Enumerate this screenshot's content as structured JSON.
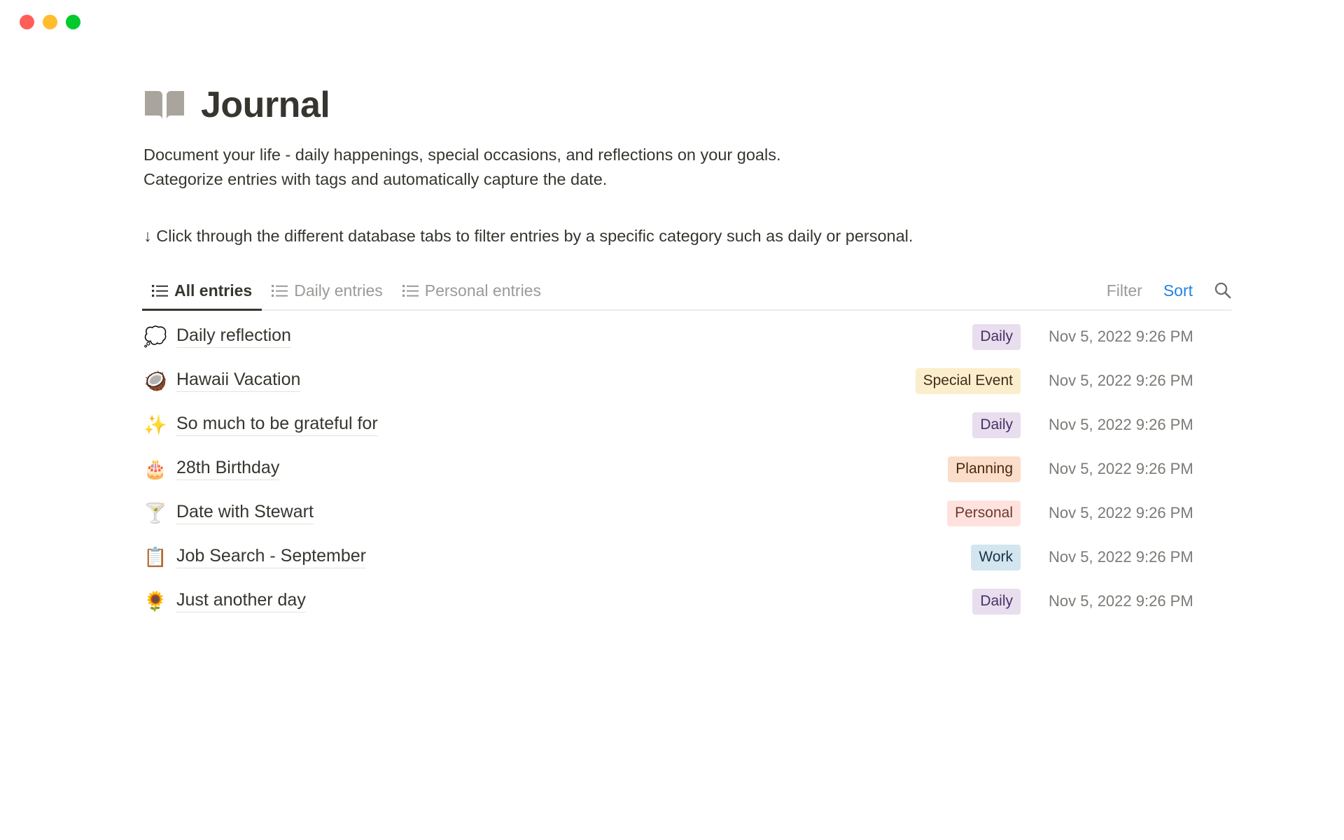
{
  "window": {
    "controls": [
      {
        "name": "close",
        "color": "#FF5F57"
      },
      {
        "name": "minimize",
        "color": "#FFBD2E"
      },
      {
        "name": "maximize",
        "color": "#00CA2C"
      }
    ]
  },
  "header": {
    "icon": "open-book-icon",
    "icon_color": "#A9A49C",
    "title": "Journal",
    "description_line1": "Document your life - daily happenings, special occasions, and reflections on your goals.",
    "description_line2": "Categorize entries with tags and automatically capture the date.",
    "hint": "↓ Click through the different database tabs to filter entries by a specific category such as daily or personal."
  },
  "toolbar": {
    "tabs": [
      {
        "label": "All entries",
        "icon": "list-icon",
        "active": true
      },
      {
        "label": "Daily entries",
        "icon": "list-icon",
        "active": false
      },
      {
        "label": "Personal entries",
        "icon": "list-icon",
        "active": false
      }
    ],
    "filter_label": "Filter",
    "sort_label": "Sort",
    "sort_color": "#2383E2",
    "search_icon": "search-icon"
  },
  "tag_styles": {
    "Daily": {
      "bg": "#E8DEEE",
      "fg": "#492F64"
    },
    "Special Event": {
      "bg": "#FBEECC",
      "fg": "#402C1B"
    },
    "Planning": {
      "bg": "#FADEC9",
      "fg": "#49290E"
    },
    "Personal": {
      "bg": "#FFE2DD",
      "fg": "#6E3630"
    },
    "Work": {
      "bg": "#D3E5EF",
      "fg": "#183347"
    }
  },
  "entries": [
    {
      "emoji": "💭",
      "emoji_name": "thought-balloon-icon",
      "title": "Daily reflection",
      "tag": "Daily",
      "date": "Nov 5, 2022 9:26 PM"
    },
    {
      "emoji": "🥥",
      "emoji_name": "coconut-icon",
      "title": "Hawaii Vacation",
      "tag": "Special Event",
      "date": "Nov 5, 2022 9:26 PM"
    },
    {
      "emoji": "✨",
      "emoji_name": "sparkles-icon",
      "title": "So much to be grateful for",
      "tag": "Daily",
      "date": "Nov 5, 2022 9:26 PM"
    },
    {
      "emoji": "🎂",
      "emoji_name": "birthday-cake-icon",
      "title": "28th Birthday",
      "tag": "Planning",
      "date": "Nov 5, 2022 9:26 PM"
    },
    {
      "emoji": "🍸",
      "emoji_name": "cocktail-glass-icon",
      "title": "Date with Stewart",
      "tag": "Personal",
      "date": "Nov 5, 2022 9:26 PM"
    },
    {
      "emoji": "📋",
      "emoji_name": "clipboard-icon",
      "title": "Job Search - September",
      "tag": "Work",
      "date": "Nov 5, 2022 9:26 PM"
    },
    {
      "emoji": "🌻",
      "emoji_name": "sunflower-icon",
      "title": "Just another day",
      "tag": "Daily",
      "date": "Nov 5, 2022 9:26 PM"
    }
  ]
}
